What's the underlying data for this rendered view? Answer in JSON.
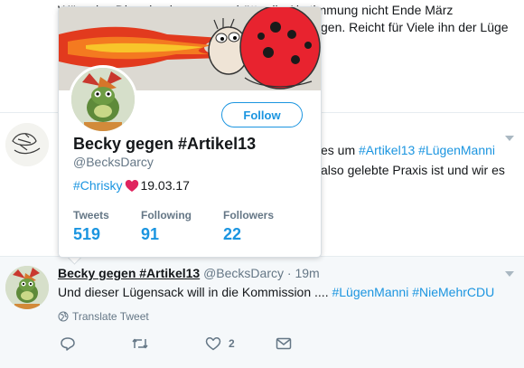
{
  "background_tweets": {
    "top_line1": "Wäre das Ding durchgegangen hätte die Abstimmung nicht Ende März",
    "top_line2_suffix": "gen. Reicht für Viele ihn der Lüge",
    "mid_line1_prefix": "es um ",
    "mid_line1_tag1": "#Artikel13",
    "mid_line1_tag2": "#LügenManni",
    "mid_line2_suffix": "also gelebte Praxis ist und wir es"
  },
  "hover_card": {
    "follow_label": "Follow",
    "name": "Becky gegen #Artikel13",
    "handle": "@BecksDarcy",
    "bio_tag": "#Chrisky",
    "bio_date": "19.03.17",
    "stats": [
      {
        "label": "Tweets",
        "value": "519"
      },
      {
        "label": "Following",
        "value": "91"
      },
      {
        "label": "Followers",
        "value": "22"
      }
    ]
  },
  "tweet": {
    "author_name": "Becky gegen #Artikel13",
    "author_handle": "@BecksDarcy",
    "dot": "·",
    "time": "19m",
    "text_prefix": "Und dieser Lügensack will in die Kommission .... ",
    "tag1": "#LügenManni",
    "tag2": "#NieMehrCDU",
    "translate_label": "Translate Tweet",
    "like_count": "2"
  },
  "colors": {
    "accent": "#1b95e0",
    "heart": "#e0245e",
    "ladybug_red": "#e8232f",
    "highlight_bg": "#f5f8fa"
  }
}
